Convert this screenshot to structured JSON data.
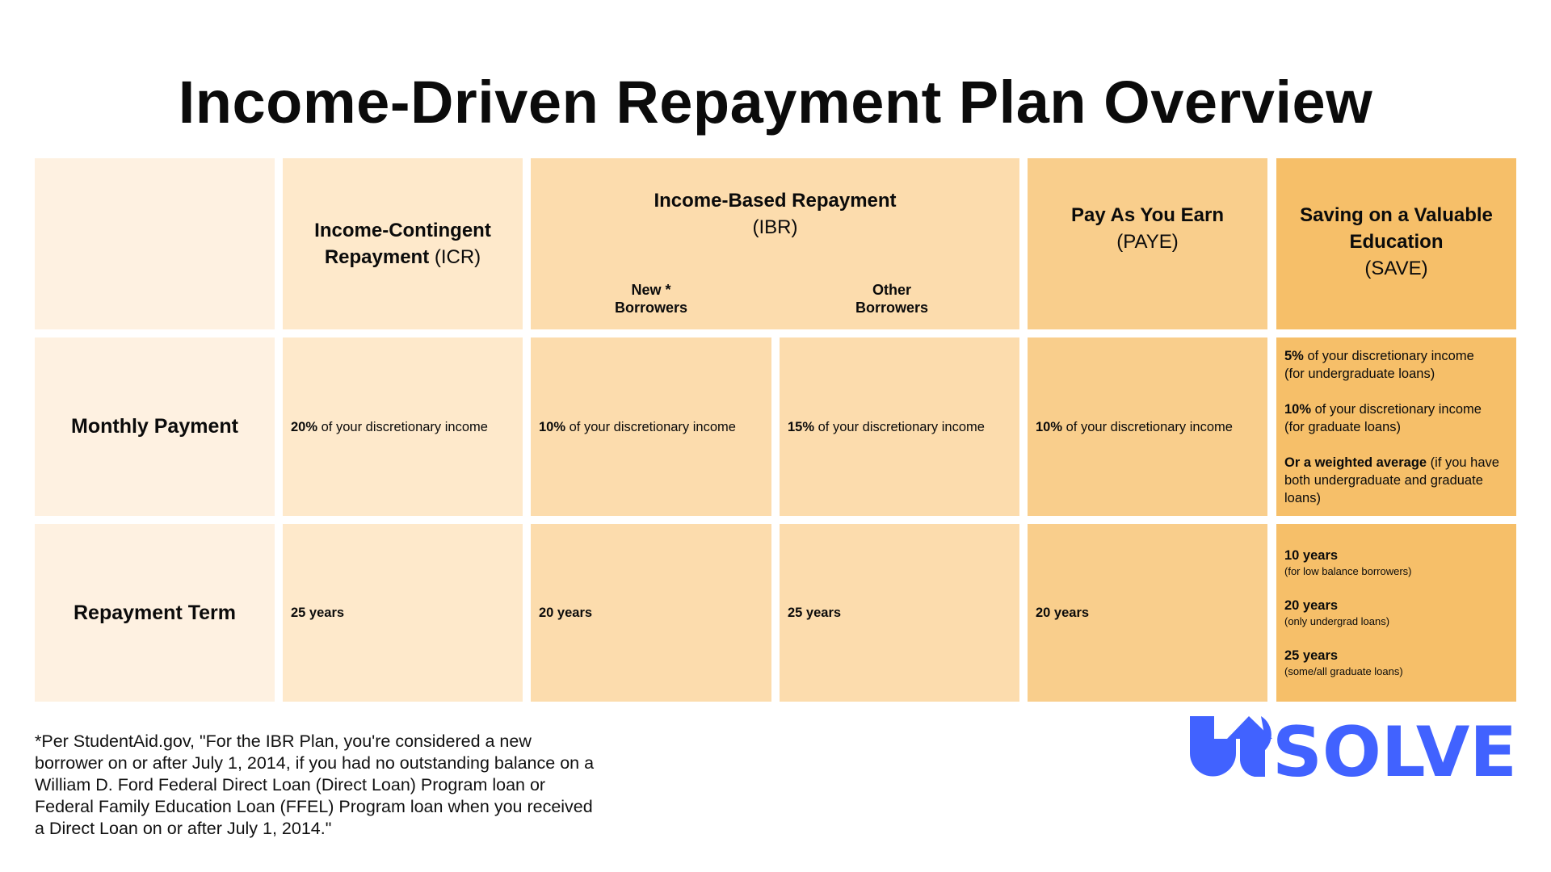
{
  "title": "Income-Driven Repayment Plan Overview",
  "colors": {
    "col_label": "#FEF1E1",
    "col_icr": "#FEE9CB",
    "col_ibr": "#FCDCAD",
    "col_paye": "#F9CE8C",
    "col_save": "#F6BF69",
    "brand_blue": "#4162FF"
  },
  "plans": {
    "icr": {
      "name": "Income-Contingent Repayment",
      "name_line1": "Income-Contingent",
      "name_line2": "Repayment",
      "abbr": "(ICR)"
    },
    "ibr": {
      "name": "Income-Based Repayment",
      "abbr": "(IBR)",
      "sub_new_line1": "New *",
      "sub_new_line2": "Borrowers",
      "sub_other_line1": "Other",
      "sub_other_line2": "Borrowers"
    },
    "paye": {
      "name": "Pay As You Earn",
      "abbr": "(PAYE)"
    },
    "save": {
      "name_line1": "Saving on a Valuable",
      "name_line2": "Education",
      "abbr": "(SAVE)"
    }
  },
  "rows": {
    "monthly_payment": {
      "label": "Monthly Payment",
      "icr": {
        "pct": "20%",
        "text": " of your discretionary income"
      },
      "ibr_new": {
        "pct": "10%",
        "text": " of your discretionary income"
      },
      "ibr_other": {
        "pct": "15%",
        "text": " of your discretionary income"
      },
      "paye": {
        "pct": "10%",
        "text": " of your discretionary income"
      },
      "save": [
        {
          "bold": "5%",
          "text": " of your discretionary income",
          "line2": "(for undergraduate loans)"
        },
        {
          "bold": "10%",
          "text": " of your discretionary income",
          "line2": "(for graduate loans)"
        },
        {
          "bold": "Or a weighted average",
          "text": " (if you have both undergraduate and graduate loans)",
          "line2": ""
        }
      ]
    },
    "repayment_term": {
      "label": "Repayment Term",
      "icr": "25 years",
      "ibr_new": "20 years",
      "ibr_other": "25 years",
      "paye": "20 years",
      "save": [
        {
          "years": "10 years",
          "note": "(for low balance borrowers)"
        },
        {
          "years": "20 years",
          "note": "(only undergrad loans)"
        },
        {
          "years": "25 years",
          "note": "(some/all graduate loans)"
        }
      ]
    }
  },
  "footnote": "*Per StudentAid.gov, \"For the IBR Plan, you're considered a new borrower on or after July 1, 2014, if you had no outstanding balance on a William D. Ford Federal Direct Loan (Direct Loan) Program loan or Federal Family Education Loan (FFEL) Program loan when you received a Direct Loan on or after July 1, 2014.\"",
  "logo": {
    "text": "SOLVE",
    "brand": "Upsolve",
    "icon": "up-arrow-icon"
  }
}
